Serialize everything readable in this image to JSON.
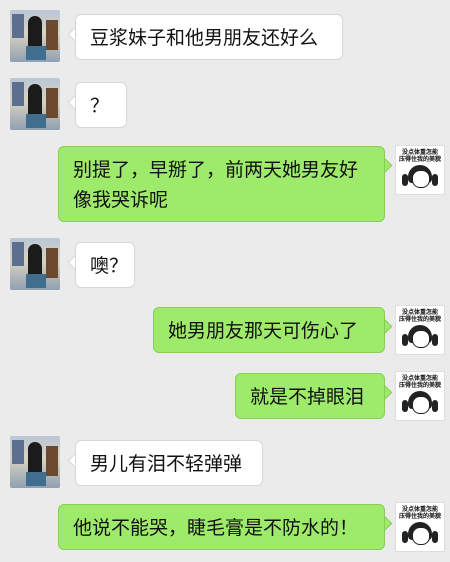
{
  "contact_avatar": "friend-photo-avatar",
  "me_avatar": {
    "caption_line1": "没点体重怎能",
    "caption_line2": "压得住我的美貌"
  },
  "messages": [
    {
      "from": "friend",
      "text": "豆浆妹子和他男朋友还好么"
    },
    {
      "from": "friend",
      "text": "？"
    },
    {
      "from": "me",
      "text": "别提了，早掰了，前两天她男友好像我哭诉呢"
    },
    {
      "from": "friend",
      "text": "噢？"
    },
    {
      "from": "me",
      "text": "她男朋友那天可伤心了"
    },
    {
      "from": "me",
      "text": "就是不掉眼泪"
    },
    {
      "from": "friend",
      "text": "男儿有泪不轻弹弹"
    },
    {
      "from": "me",
      "text": "他说不能哭，睫毛膏是不防水的！"
    }
  ],
  "colors": {
    "background": "#ebebeb",
    "incoming_bubble": "#ffffff",
    "outgoing_bubble": "#9eea6a"
  }
}
